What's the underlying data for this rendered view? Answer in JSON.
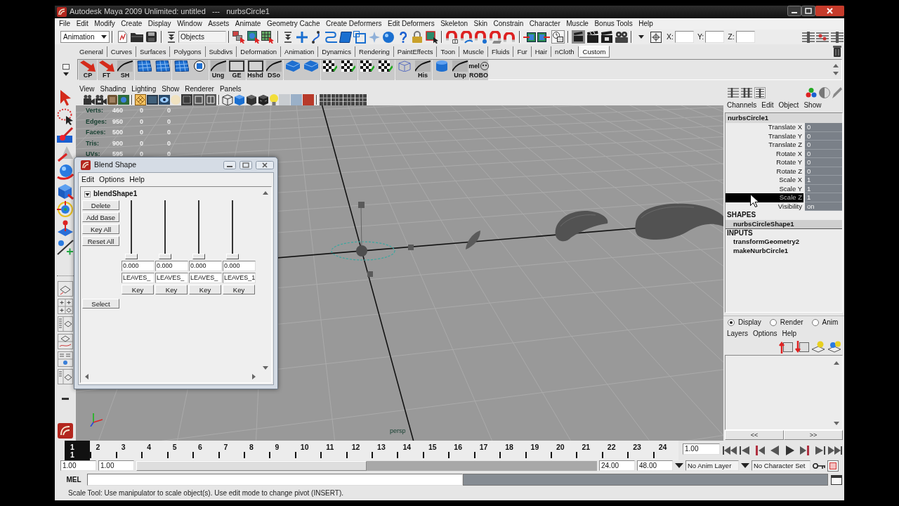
{
  "window": {
    "title": "Autodesk Maya 2009 Unlimited: untitled   ---   nurbsCircle1"
  },
  "menu_bar": [
    "File",
    "Edit",
    "Modify",
    "Create",
    "Display",
    "Window",
    "Assets",
    "Animate",
    "Geometry Cache",
    "Create Deformers",
    "Edit Deformers",
    "Skeleton",
    "Skin",
    "Constrain",
    "Character",
    "Muscle",
    "Bonus Tools",
    "Help"
  ],
  "status_line": {
    "menu_set": "Animation",
    "selection_mode": "Objects",
    "coordinates": [
      "X:",
      "Y:",
      "Z:"
    ]
  },
  "shelf_tabs": [
    {
      "label": "General",
      "selected": false
    },
    {
      "label": "Curves",
      "selected": false
    },
    {
      "label": "Surfaces",
      "selected": false
    },
    {
      "label": "Polygons",
      "selected": false
    },
    {
      "label": "Subdivs",
      "selected": false
    },
    {
      "label": "Deformation",
      "selected": false
    },
    {
      "label": "Animation",
      "selected": false
    },
    {
      "label": "Dynamics",
      "selected": false
    },
    {
      "label": "Rendering",
      "selected": false
    },
    {
      "label": "PaintEffects",
      "selected": false
    },
    {
      "label": "Toon",
      "selected": false
    },
    {
      "label": "Muscle",
      "selected": false
    },
    {
      "label": "Fluids",
      "selected": false
    },
    {
      "label": "Fur",
      "selected": false
    },
    {
      "label": "Hair",
      "selected": false
    },
    {
      "label": "nCloth",
      "selected": false
    },
    {
      "label": "Custom",
      "selected": true
    }
  ],
  "shelf": [
    {
      "kind": "arrow",
      "label": "CP"
    },
    {
      "kind": "arrow",
      "label": "FT"
    },
    {
      "kind": "curve",
      "label": "SH"
    },
    {
      "kind": "grid"
    },
    {
      "kind": "grid"
    },
    {
      "kind": "grid"
    },
    {
      "kind": "target"
    },
    {
      "kind": "curve",
      "label": "Ung"
    },
    {
      "kind": "frame",
      "label": "GE"
    },
    {
      "kind": "frame",
      "label": "Hshd"
    },
    {
      "kind": "curve",
      "label": "DSo"
    },
    {
      "kind": "cube"
    },
    {
      "kind": "cube"
    },
    {
      "kind": "checker"
    },
    {
      "kind": "checker"
    },
    {
      "kind": "checker"
    },
    {
      "kind": "checker"
    },
    {
      "kind": "wire"
    },
    {
      "kind": "curve",
      "label": "His"
    },
    {
      "kind": "cylinder"
    },
    {
      "kind": "curve",
      "label": "Unp"
    },
    {
      "kind": "script",
      "top_label": "mel",
      "label": "ROBO"
    }
  ],
  "viewport": {
    "menu": [
      "View",
      "Shading",
      "Lighting",
      "Show",
      "Renderer",
      "Panels"
    ],
    "hud": [
      {
        "label": "Verts:",
        "values": [
          "460",
          "0",
          "0"
        ]
      },
      {
        "label": "Edges:",
        "values": [
          "950",
          "0",
          "0"
        ]
      },
      {
        "label": "Faces:",
        "values": [
          "500",
          "0",
          "0"
        ]
      },
      {
        "label": "Tris:",
        "values": [
          "900",
          "0",
          "0"
        ]
      },
      {
        "label": "UVs:",
        "values": [
          "595",
          "0",
          "0"
        ]
      }
    ],
    "camera": "persp"
  },
  "blend_shape": {
    "title": "Blend Shape",
    "menu": [
      "Edit",
      "Options",
      "Help"
    ],
    "node": {
      "name": "blendShape1",
      "expanded": true
    },
    "buttons": [
      "Delete",
      "Add Base",
      "Key All",
      "Reset All"
    ],
    "targets": [
      {
        "level": 0,
        "value": "0.000",
        "name": "LEAVES_",
        "key": "Key"
      },
      {
        "level": 0,
        "value": "0.000",
        "name": "LEAVES_",
        "key": "Key"
      },
      {
        "level": 0,
        "value": "0.000",
        "name": "LEAVES_",
        "key": "Key"
      },
      {
        "level": 0,
        "value": "0.000",
        "name": "LEAVES_1",
        "key": "Key"
      }
    ],
    "select": "Select"
  },
  "channel_box": {
    "menu": [
      "Channels",
      "Edit",
      "Object",
      "Show"
    ],
    "node": "nurbsCircle1",
    "channels": [
      {
        "name": "Translate X",
        "value": "0",
        "selected": false
      },
      {
        "name": "Translate Y",
        "value": "0",
        "selected": false
      },
      {
        "name": "Translate Z",
        "value": "0",
        "selected": false
      },
      {
        "name": "Rotate X",
        "value": "0",
        "selected": false
      },
      {
        "name": "Rotate Y",
        "value": "0",
        "selected": false
      },
      {
        "name": "Rotate Z",
        "value": "0",
        "selected": false
      },
      {
        "name": "Scale X",
        "value": "1",
        "selected": false
      },
      {
        "name": "Scale Y",
        "value": "1",
        "selected": false
      },
      {
        "name": "Scale Z",
        "value": "1",
        "selected": true
      },
      {
        "name": "Visibility",
        "value": "on",
        "selected": false
      }
    ],
    "shapes_heading": "SHAPES",
    "shapes": [
      "nurbsCircleShape1"
    ],
    "inputs_heading": "INPUTS",
    "inputs": [
      "transformGeometry2",
      "makeNurbCircle1"
    ]
  },
  "layer_editor": {
    "modes": [
      {
        "label": "Display",
        "selected": true
      },
      {
        "label": "Render",
        "selected": false
      },
      {
        "label": "Anim",
        "selected": false
      }
    ],
    "menu": [
      "Layers",
      "Options",
      "Help"
    ],
    "pager": [
      "<<",
      ">>"
    ]
  },
  "time_slider": {
    "frames": [
      {
        "label": "1",
        "selected": true
      },
      {
        "label": "2",
        "selected": false
      },
      {
        "label": "3",
        "selected": false
      },
      {
        "label": "4",
        "selected": false
      },
      {
        "label": "5",
        "selected": false
      },
      {
        "label": "6",
        "selected": false
      },
      {
        "label": "7",
        "selected": false
      },
      {
        "label": "8",
        "selected": false
      },
      {
        "label": "9",
        "selected": false
      },
      {
        "label": "10",
        "selected": false
      },
      {
        "label": "11",
        "selected": false
      },
      {
        "label": "12",
        "selected": false
      },
      {
        "label": "13",
        "selected": false
      },
      {
        "label": "14",
        "selected": false
      },
      {
        "label": "15",
        "selected": false
      },
      {
        "label": "16",
        "selected": false
      },
      {
        "label": "17",
        "selected": false
      },
      {
        "label": "18",
        "selected": false
      },
      {
        "label": "19",
        "selected": false
      },
      {
        "label": "20",
        "selected": false
      },
      {
        "label": "21",
        "selected": false
      },
      {
        "label": "22",
        "selected": false
      },
      {
        "label": "23",
        "selected": false
      },
      {
        "label": "24",
        "selected": false
      }
    ],
    "current_frame": "1",
    "current_time": "1.00"
  },
  "range_slider": {
    "start": "1.00",
    "playback_start": "1.00",
    "level": 0.5,
    "playback_end": "24.00",
    "end": "48.00",
    "anim_layer": "No Anim Layer",
    "character_set": "No Character Set"
  },
  "command_line": {
    "label": "MEL"
  },
  "help_line": "Scale Tool: Use manipulator to scale object(s). Use edit mode to change pivot (INSERT)."
}
